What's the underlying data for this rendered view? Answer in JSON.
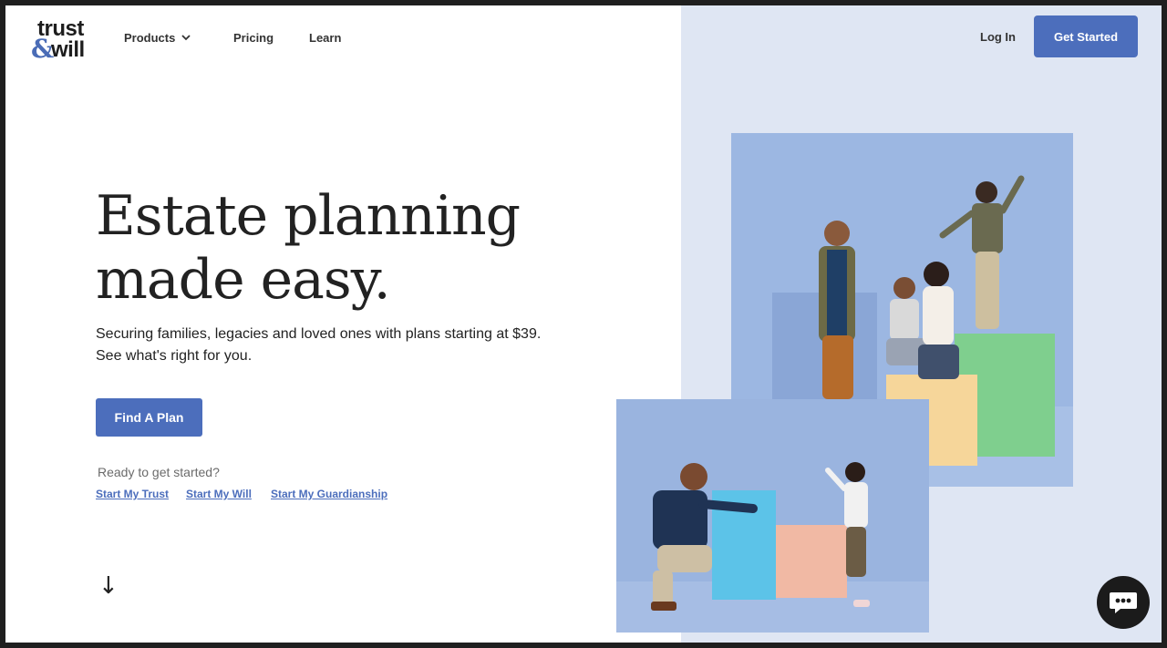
{
  "header": {
    "logo_top": "trust",
    "logo_amp": "&",
    "logo_bottom": "will",
    "nav": {
      "products": "Products",
      "pricing": "Pricing",
      "learn": "Learn"
    },
    "login": "Log In",
    "get_started": "Get Started"
  },
  "hero": {
    "title_line1": "Estate planning",
    "title_line2": "made easy.",
    "subtitle_line1": "Securing families, legacies and loved ones with plans starting at $39.",
    "subtitle_line2": "See what's right for you.",
    "cta": "Find A Plan",
    "ready_text": "Ready to get started?",
    "links": {
      "trust": "Start My Trust",
      "will": "Start My Will",
      "guardianship": "Start My Guardianship"
    },
    "scroll_arrow": "↓"
  },
  "colors": {
    "accent": "#4c6ebc",
    "panel_bg": "#dfe6f3"
  },
  "icons": {
    "products_dropdown": "chevron-down-icon",
    "chat": "chat-bubble-icon",
    "scroll": "arrow-down-icon"
  }
}
